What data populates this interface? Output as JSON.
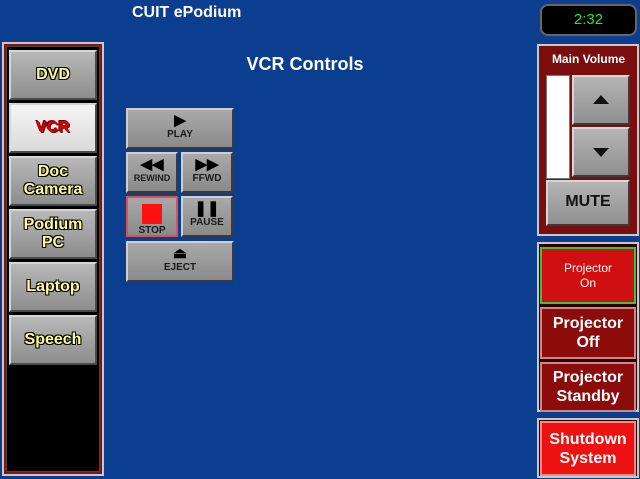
{
  "header": {
    "app_title": "CUIT ePodium",
    "clock": "2:32"
  },
  "main": {
    "page_title": "VCR Controls"
  },
  "sources": [
    {
      "label": "DVD",
      "active": false
    },
    {
      "label": "VCR",
      "active": true
    },
    {
      "label": "Doc Camera",
      "active": false
    },
    {
      "label": "Podium PC",
      "active": false
    },
    {
      "label": "Laptop",
      "active": false
    },
    {
      "label": "Speech",
      "active": false
    }
  ],
  "transport": {
    "play": "PLAY",
    "rewind": "REWIND",
    "ffwd": "FFWD",
    "stop": "STOP",
    "pause": "PAUSE",
    "eject": "EJECT"
  },
  "volume": {
    "label": "Main Volume",
    "mute_label": "MUTE",
    "level": 0.0
  },
  "projector": {
    "on_label": "Projector On",
    "off_label": "Projector Off",
    "standby_label": "Projector Standby"
  },
  "system": {
    "shutdown_label": "Shutdown System"
  },
  "colors": {
    "background": "#0b3e8f",
    "accent_red": "#e00000",
    "clock_green": "#30e030"
  }
}
